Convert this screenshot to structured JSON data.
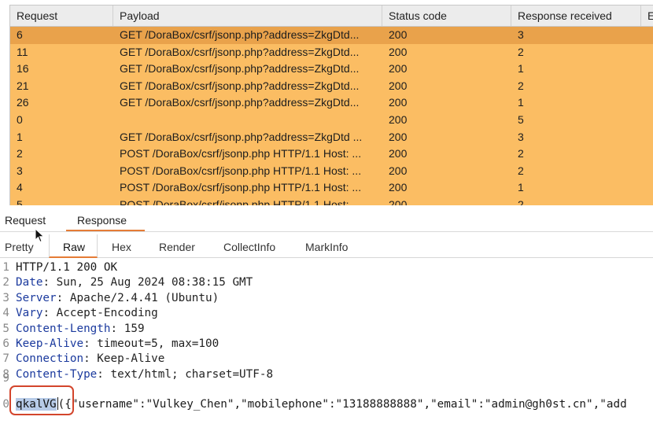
{
  "table": {
    "columns": [
      "Request",
      "Payload",
      "Status code",
      "Response received",
      "E"
    ],
    "rows": [
      {
        "request": "6",
        "payload": "GET /DoraBox/csrf/jsonp.php?address=ZkgDtd...",
        "status": "200",
        "received": "3",
        "selected": true
      },
      {
        "request": "11",
        "payload": "GET /DoraBox/csrf/jsonp.php?address=ZkgDtd...",
        "status": "200",
        "received": "2",
        "selected": false
      },
      {
        "request": "16",
        "payload": "GET /DoraBox/csrf/jsonp.php?address=ZkgDtd...",
        "status": "200",
        "received": "1",
        "selected": false
      },
      {
        "request": "21",
        "payload": "GET /DoraBox/csrf/jsonp.php?address=ZkgDtd...",
        "status": "200",
        "received": "2",
        "selected": false
      },
      {
        "request": "26",
        "payload": "GET /DoraBox/csrf/jsonp.php?address=ZkgDtd...",
        "status": "200",
        "received": "1",
        "selected": false
      },
      {
        "request": "0",
        "payload": "",
        "status": "200",
        "received": "5",
        "selected": false
      },
      {
        "request": "1",
        "payload": "GET /DoraBox/csrf/jsonp.php?address=ZkgDtd ...",
        "status": "200",
        "received": "3",
        "selected": false
      },
      {
        "request": "2",
        "payload": "POST /DoraBox/csrf/jsonp.php HTTP/1.1  Host: ...",
        "status": "200",
        "received": "2",
        "selected": false
      },
      {
        "request": "3",
        "payload": "POST /DoraBox/csrf/jsonp.php HTTP/1.1  Host: ...",
        "status": "200",
        "received": "2",
        "selected": false
      },
      {
        "request": "4",
        "payload": "POST /DoraBox/csrf/jsonp.php HTTP/1.1  Host: ...",
        "status": "200",
        "received": "1",
        "selected": false
      },
      {
        "request": "5",
        "payload": "POST /DoraBox/csrf/jsonp.php HTTP/1.1  Host: ...",
        "status": "200",
        "received": "2",
        "selected": false
      }
    ]
  },
  "panel_tabs": {
    "request": "Request",
    "response": "Response",
    "active": "Response"
  },
  "view_tabs": {
    "items": [
      "Pretty",
      "Raw",
      "Hex",
      "Render",
      "CollectInfo",
      "MarkInfo"
    ],
    "active": "Raw"
  },
  "response": {
    "status_line": "HTTP/1.1 200 OK",
    "headers": [
      {
        "num": "2",
        "key": "Date",
        "value": "Sun, 25 Aug 2024 08:38:15 GMT"
      },
      {
        "num": "3",
        "key": "Server",
        "value": "Apache/2.4.41 (Ubuntu)"
      },
      {
        "num": "4",
        "key": "Vary",
        "value": "Accept-Encoding"
      },
      {
        "num": "5",
        "key": "Content-Length",
        "value": "159"
      },
      {
        "num": "6",
        "key": "Keep-Alive",
        "value": "timeout=5, max=100"
      },
      {
        "num": "7",
        "key": "Connection",
        "value": "Keep-Alive"
      },
      {
        "num": "8",
        "key": "Content-Type",
        "value": "text/html; charset=UTF-8"
      }
    ],
    "line_numbers": [
      "1",
      "9",
      "0"
    ],
    "body_callback": "qkalVG",
    "body_rest": "({\"username\":\"Vulkey_Chen\",\"mobilephone\":\"13188888888\",\"email\":\"admin@gh0st.cn\",\"add"
  },
  "colors": {
    "row": "#fbbd63",
    "row_selected": "#e9a24b",
    "accent": "#e57c36",
    "annotation": "#d3452c"
  },
  "icons": {
    "pointer": "mouse-pointer-icon"
  }
}
